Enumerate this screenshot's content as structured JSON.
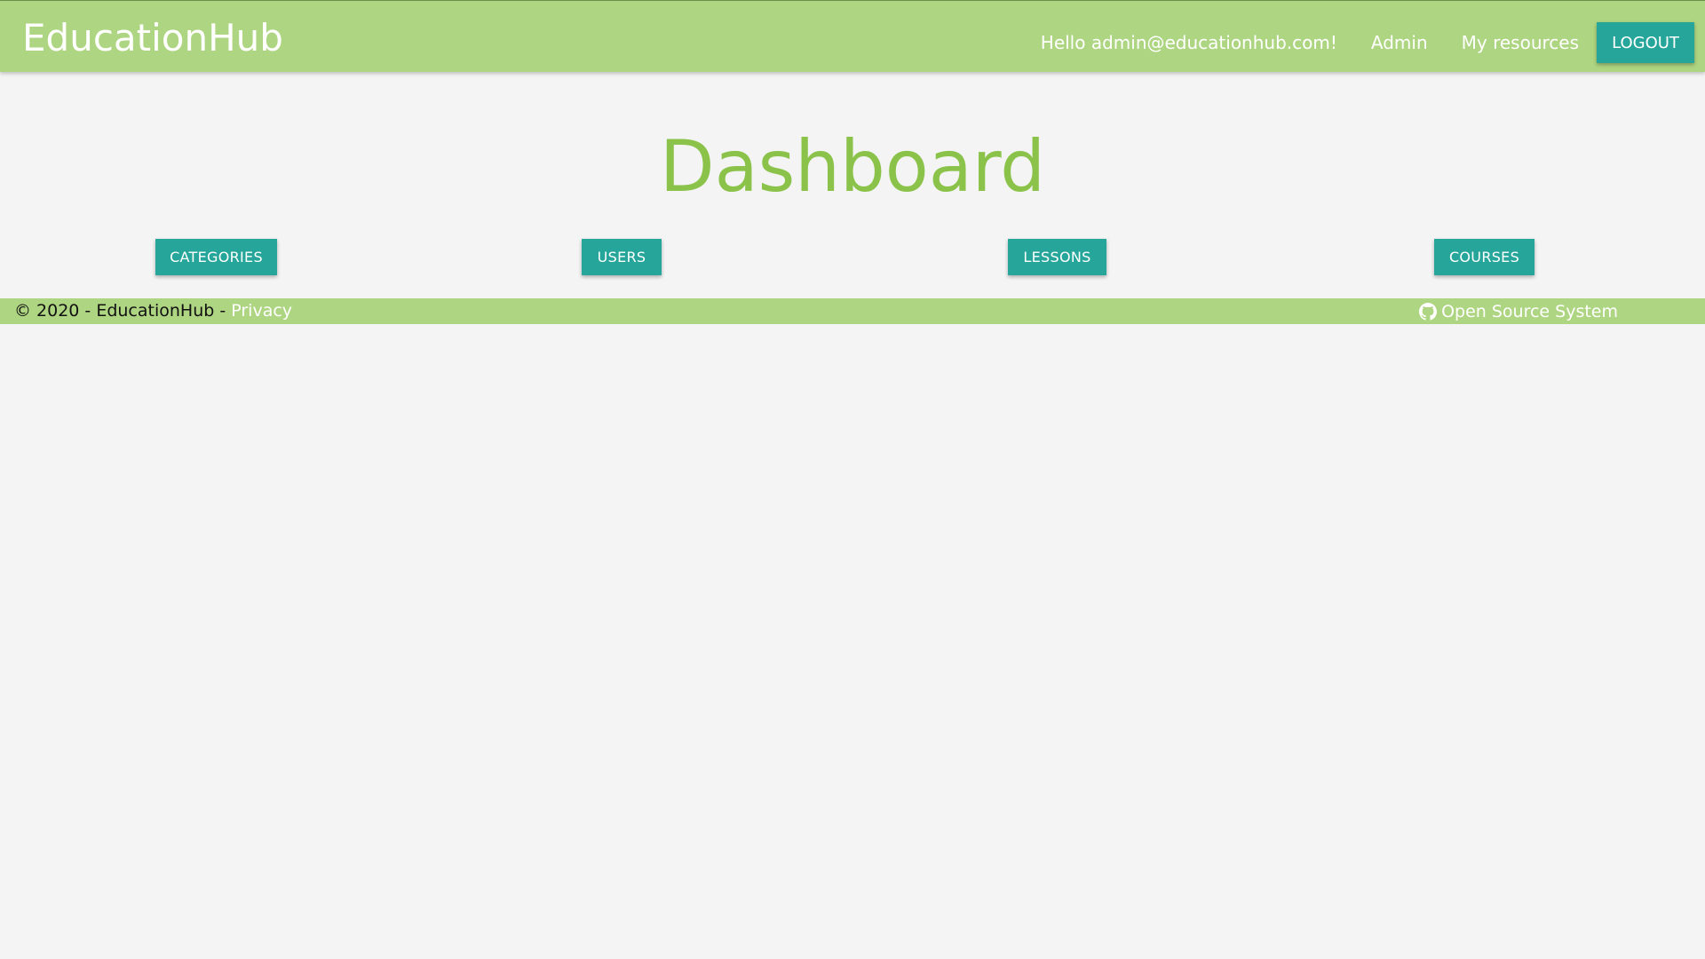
{
  "navbar": {
    "brand": "EducationHub",
    "greeting": "Hello admin@educationhub.com!",
    "links": [
      "Admin",
      "My resources"
    ],
    "logout_label": "LOGOUT"
  },
  "main": {
    "title": "Dashboard",
    "buttons": [
      "CATEGORIES",
      "USERS",
      "LESSONS",
      "COURSES"
    ]
  },
  "footer": {
    "copyright": "© 2020 - EducationHub - ",
    "privacy_label": "Privacy",
    "github_icon": "github-icon",
    "open_source_label": "Open Source System"
  },
  "colors": {
    "header_bg": "#aed581",
    "accent": "#26a69a",
    "title": "#8bc34a",
    "page_bg": "#f4f4f4"
  }
}
